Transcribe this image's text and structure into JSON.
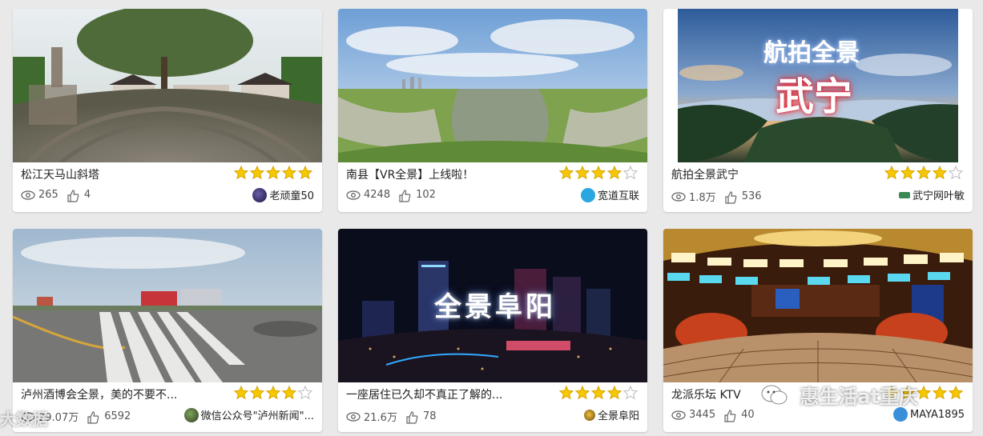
{
  "cards": [
    {
      "title": "松江天马山斜塔",
      "rating": 5,
      "views": "265",
      "likes": "4",
      "author": "老顽童50",
      "overlay": ""
    },
    {
      "title": "南县【VR全景】上线啦！",
      "rating": 4,
      "views": "4248",
      "likes": "102",
      "author": "宽道互联",
      "overlay": ""
    },
    {
      "title": "航拍全景武宁",
      "rating": 4,
      "views": "1.8万",
      "likes": "536",
      "author": "武宁网叶敏",
      "overlay": "航拍全景",
      "overlay2": "武宁"
    },
    {
      "title": "泸州酒博会全景，美的不要不...",
      "rating": 4,
      "views": "29.07万",
      "likes": "6592",
      "author": "微信公众号\"泸州新闻\"...",
      "overlay": ""
    },
    {
      "title": "一座居住已久却不真正了解的...",
      "rating": 4,
      "views": "21.6万",
      "likes": "78",
      "author": "全景阜阳",
      "overlay": "全景阜阳"
    },
    {
      "title": "龙派乐坛 KTV",
      "rating": 5,
      "views": "3445",
      "likes": "40",
      "author": "MAYA1895",
      "overlay": ""
    }
  ],
  "watermarks": {
    "right": "惠生活at重庆",
    "left": "大数据"
  },
  "icons": {
    "view": "eye-icon",
    "like": "thumbs-up-icon",
    "star": "star-icon"
  },
  "colors": {
    "star_on": "#f6c800",
    "star_off": "#cccccc",
    "text": "#222222",
    "muted": "#555555"
  }
}
